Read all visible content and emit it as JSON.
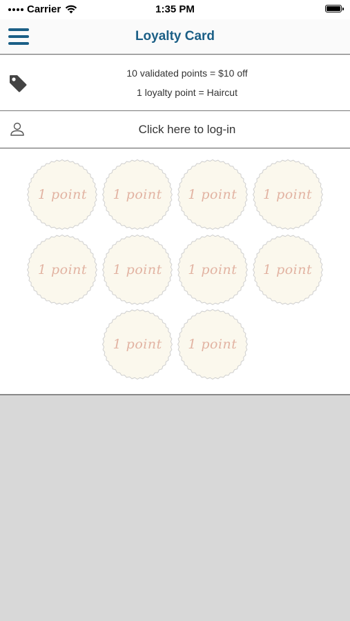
{
  "status_bar": {
    "carrier": "Carrier",
    "time": "1:35 PM"
  },
  "nav": {
    "title": "Loyalty Card",
    "menu_icon": "hamburger-menu-icon"
  },
  "offer": {
    "icon": "tag-icon",
    "line1": "10 validated points = $10 off",
    "line2": "1 loyalty point = Haircut"
  },
  "login": {
    "icon": "user-icon",
    "label": "Click here to log-in"
  },
  "stamps": [
    {
      "label": "1 point"
    },
    {
      "label": "1 point"
    },
    {
      "label": "1 point"
    },
    {
      "label": "1 point"
    },
    {
      "label": "1 point"
    },
    {
      "label": "1 point"
    },
    {
      "label": "1 point"
    },
    {
      "label": "1 point"
    },
    {
      "label": "1 point"
    },
    {
      "label": "1 point"
    }
  ],
  "colors": {
    "accent": "#1b5f86",
    "stamp_fill": "#fbf8ed",
    "stamp_edge": "#cfcfcf",
    "stamp_text": "#e2b3a2",
    "background": "#d8d8d8"
  }
}
